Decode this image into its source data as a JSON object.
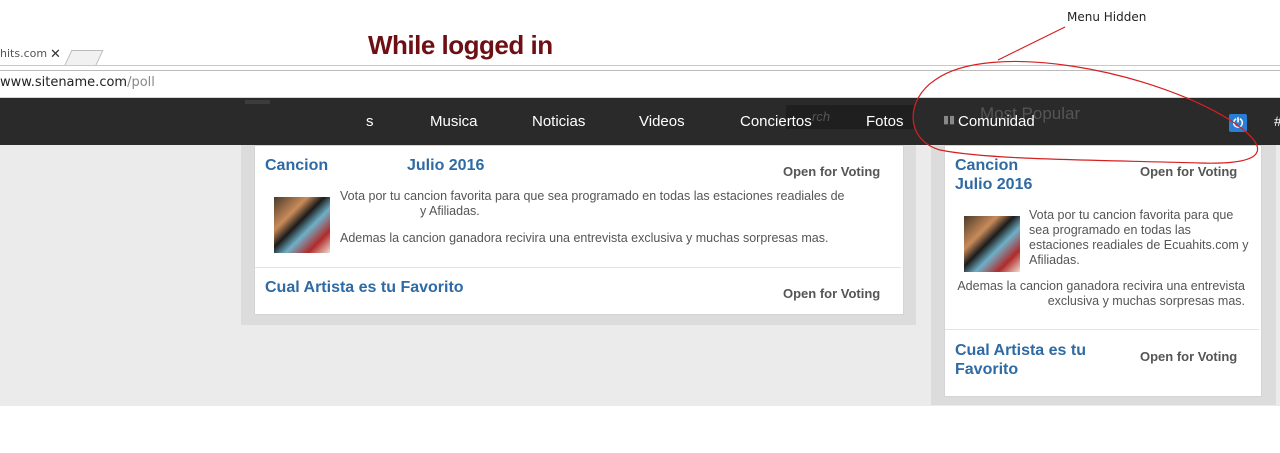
{
  "browser": {
    "tab_title": "hits.com",
    "tab_close": "✕",
    "url_host": "www.sitename.com",
    "url_path": "/poll"
  },
  "captions": {
    "logged_in": "While logged in",
    "menu_hidden": "Menu Hidden"
  },
  "nav": {
    "items": [
      "s",
      "Musica",
      "Noticias",
      "Videos",
      "Conciertos",
      "Fotos",
      "Comunidad"
    ],
    "search_placeholder": "rch",
    "popular_ghost": "Most Popular",
    "hash": "#"
  },
  "main_polls": [
    {
      "title": "Cancion",
      "title_date": "Julio 2016",
      "status": "Open for Voting",
      "desc1": "Vota por tu cancion favorita para que sea programado en todas las estaciones readiales de",
      "desc1b": "y Afiliadas.",
      "desc2": "Ademas la cancion ganadora recivira una entrevista exclusiva y muchas sorpresas mas."
    },
    {
      "title": "Cual Artista es tu Favorito",
      "status": "Open for Voting"
    }
  ],
  "side_polls": [
    {
      "title_line1": "Cancion",
      "title_line2": "Julio 2016",
      "status": "Open for Voting",
      "desc1": "Vota por tu cancion favorita para que sea programado en todas las estaciones readiales de Ecuahits.com y Afiliadas.",
      "desc2": "Ademas la cancion ganadora recivira una entrevista exclusiva y muchas sorpresas mas."
    },
    {
      "title_line1": "Cual Artista es tu",
      "title_line2": "Favorito",
      "status": "Open for Voting"
    }
  ],
  "colors": {
    "nav_bg": "#2a2a2a",
    "link_blue": "#2e6aa3",
    "caption_red": "#6e0f14",
    "annotation_red": "#d62020",
    "power_blue": "#2a7fd4"
  },
  "icons": {
    "power": "power-icon",
    "bar_chart": "bar-chart-icon"
  }
}
